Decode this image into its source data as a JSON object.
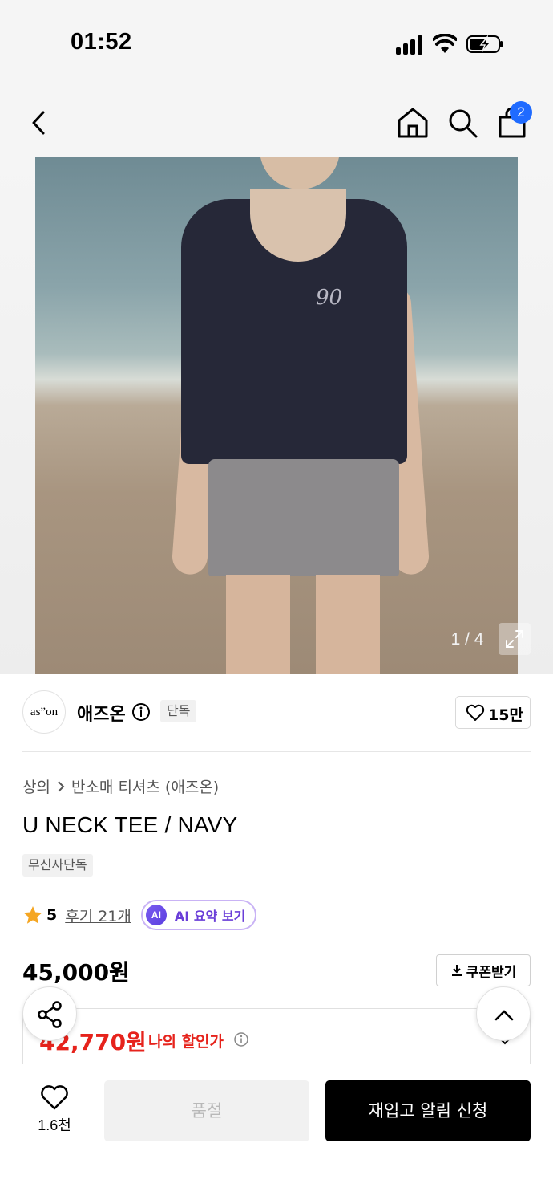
{
  "status_bar": {
    "time": "01:52"
  },
  "header": {
    "cart_count": "2"
  },
  "gallery": {
    "page_indicator": "1 / 4"
  },
  "brand": {
    "logo_text": "as”on",
    "name": "애즈온",
    "exclusive_tag": "단독",
    "like_count": "15만"
  },
  "breadcrumb": {
    "category": "상의",
    "subcategory": "반소매 티셔츠 (애즈온)"
  },
  "product": {
    "title": "U NECK TEE / NAVY",
    "musinsa_tag": "무신사단독",
    "rating": "5",
    "review_link": "후기 21개",
    "ai_badge": "AI",
    "ai_label": "AI 요약 보기",
    "price": "45,000원",
    "coupon_label": "쿠폰받기",
    "discount_price": "42,770원",
    "discount_label": "나의 할인가"
  },
  "bottom_bar": {
    "wish_count": "1.6천",
    "soldout_label": "품절",
    "restock_label": "재입고 알림 신청"
  },
  "colors": {
    "accent_blue": "#1f6bff",
    "discount_red": "#e6231c",
    "ai_purple": "#6a3ed8"
  },
  "icons": [
    "back-icon",
    "home-icon",
    "search-icon",
    "cart-icon",
    "expand-icon",
    "info-icon",
    "heart-icon",
    "star-icon",
    "download-icon",
    "share-icon",
    "chevron-up-icon",
    "chevron-down-icon"
  ]
}
